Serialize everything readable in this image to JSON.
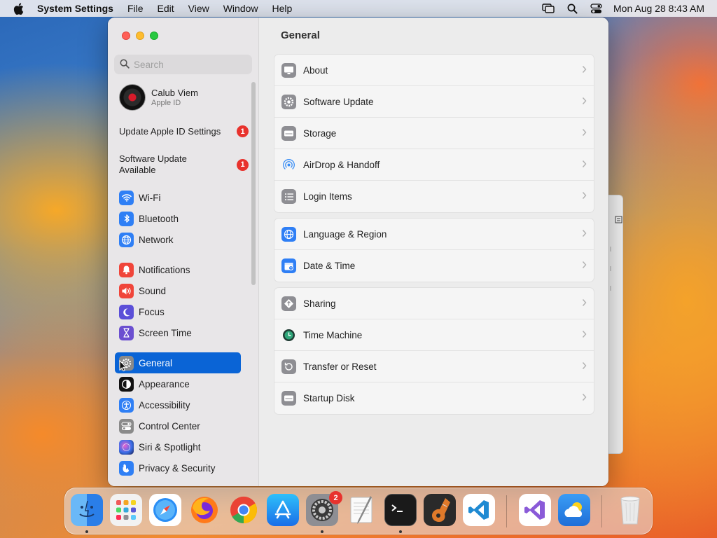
{
  "menubar": {
    "apple_icon": "apple-logo-icon",
    "app_name": "System Settings",
    "menus": [
      "File",
      "Edit",
      "View",
      "Window",
      "Help"
    ],
    "status_icons": [
      "screen-mirroring-icon",
      "spotlight-search-icon",
      "control-center-icon"
    ],
    "clock": "Mon Aug 28  8:43 AM"
  },
  "window": {
    "title": "General",
    "search": {
      "placeholder": "Search",
      "value": ""
    },
    "account": {
      "name": "Calub Viem",
      "subtitle": "Apple ID"
    },
    "notices": [
      {
        "label": "Update Apple ID Settings",
        "badge": "1"
      },
      {
        "label": "Software Update Available",
        "badge": "1"
      }
    ],
    "sidebar": [
      {
        "label": "Wi-Fi",
        "icon": "wifi-icon",
        "color": "#2f7ff5"
      },
      {
        "label": "Bluetooth",
        "icon": "bluetooth-icon",
        "color": "#2f7ff5"
      },
      {
        "label": "Network",
        "icon": "network-globe-icon",
        "color": "#2f7ff5"
      },
      {
        "label": "Notifications",
        "icon": "notifications-bell-icon",
        "color": "#f0453a"
      },
      {
        "label": "Sound",
        "icon": "sound-speaker-icon",
        "color": "#f0453a"
      },
      {
        "label": "Focus",
        "icon": "focus-moon-icon",
        "color": "#5b4fd8"
      },
      {
        "label": "Screen Time",
        "icon": "screen-time-hourglass-icon",
        "color": "#6b4fd0"
      },
      {
        "label": "General",
        "icon": "general-gear-icon",
        "color": "#8a8a8a",
        "selected": true
      },
      {
        "label": "Appearance",
        "icon": "appearance-icon",
        "color": "#111111"
      },
      {
        "label": "Accessibility",
        "icon": "accessibility-icon",
        "color": "#2f7ff5"
      },
      {
        "label": "Control Center",
        "icon": "control-center-icon",
        "color": "#8a8a8a"
      },
      {
        "label": "Siri & Spotlight",
        "icon": "siri-icon",
        "color": "#3a3a8a"
      },
      {
        "label": "Privacy & Security",
        "icon": "privacy-hand-icon",
        "color": "#2f7ff5"
      }
    ],
    "groups": [
      [
        {
          "label": "About",
          "icon": "about-display-icon",
          "color": "#8e8e93"
        },
        {
          "label": "Software Update",
          "icon": "software-update-gear-icon",
          "color": "#8e8e93"
        },
        {
          "label": "Storage",
          "icon": "storage-drive-icon",
          "color": "#8e8e93"
        },
        {
          "label": "AirDrop & Handoff",
          "icon": "airdrop-icon",
          "color": "#3a8ef5"
        },
        {
          "label": "Login Items",
          "icon": "login-items-list-icon",
          "color": "#8e8e93"
        }
      ],
      [
        {
          "label": "Language & Region",
          "icon": "language-globe-icon",
          "color": "#2f7ff5"
        },
        {
          "label": "Date & Time",
          "icon": "date-time-calendar-icon",
          "color": "#2f7ff5"
        }
      ],
      [
        {
          "label": "Sharing",
          "icon": "sharing-icon",
          "color": "#8e8e93"
        },
        {
          "label": "Time Machine",
          "icon": "time-machine-icon",
          "color": "#1f6f5a"
        },
        {
          "label": "Transfer or Reset",
          "icon": "transfer-reset-icon",
          "color": "#8e8e93"
        },
        {
          "label": "Startup Disk",
          "icon": "startup-disk-icon",
          "color": "#8e8e93"
        }
      ]
    ]
  },
  "dock": {
    "apps": [
      {
        "name": "finder-icon",
        "color": "#3a8ef5",
        "running": true
      },
      {
        "name": "launchpad-icon",
        "color": "#f2f2f2",
        "running": false
      },
      {
        "name": "safari-icon",
        "color": "#3a9cf5",
        "running": false
      },
      {
        "name": "firefox-icon",
        "color": "#ff7a1a",
        "running": false
      },
      {
        "name": "chrome-icon",
        "color": "#ffffff",
        "running": false
      },
      {
        "name": "app-store-icon",
        "color": "#2a8ef8",
        "running": false
      },
      {
        "name": "system-settings-icon",
        "color": "#8e8e93",
        "running": true,
        "badge": "2"
      },
      {
        "name": "textedit-icon",
        "color": "#f5f5f5",
        "running": false
      },
      {
        "name": "terminal-icon",
        "color": "#1a1a1a",
        "running": true
      },
      {
        "name": "garageband-icon",
        "color": "#2a2a2a",
        "running": false
      },
      {
        "name": "vscode-icon",
        "color": "#ffffff",
        "running": false
      },
      {
        "name": "visual-studio-icon",
        "color": "#ffffff",
        "running": false
      },
      {
        "name": "weather-icon",
        "color": "#3a8ef5",
        "running": false
      },
      {
        "name": "trash-icon",
        "color": "#e0e0e0",
        "running": false
      }
    ]
  }
}
